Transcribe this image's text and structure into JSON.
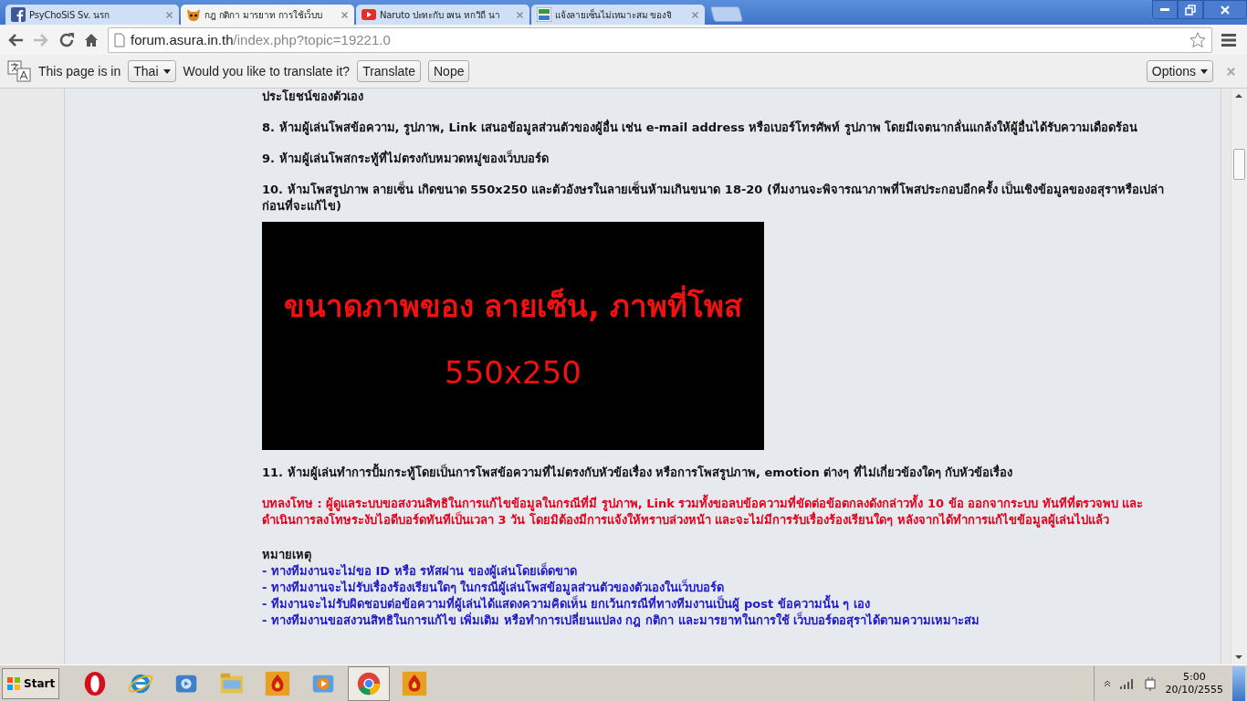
{
  "tabs": [
    {
      "title": "PsyChoSiS Sv. นรก",
      "selected": false
    },
    {
      "title": "กฎ กติกา มารยาท การใช้เว็บบ",
      "selected": true
    },
    {
      "title": "Naruto ปะทะกับ เพน หกวิถี นา",
      "selected": false
    },
    {
      "title": "แจ้งลายเซ็นไม่เหมาะสม ของจิ",
      "selected": false
    }
  ],
  "address_bar": {
    "host": "forum.asura.in.th",
    "path": "/index.php?topic=19221.0"
  },
  "translate_bar": {
    "prefix": "This page is in",
    "language": "Thai",
    "question": "Would you like to translate it?",
    "buttons": [
      "Translate",
      "Nope"
    ],
    "options": "Options"
  },
  "post": [
    {
      "kind": "rule",
      "text": "ประโยชน์ของตัวเอง"
    },
    {
      "kind": "rule",
      "text": "8. ห้ามผู้เล่นโพสข้อความ, รูปภาพ, Link เสนอข้อมูลส่วนตัวของผู้อื่น เช่น e-mail address หรือเบอร์โทรศัพท์ รูปภาพ โดยมีเจตนากลั่นแกล้งให้ผู้อื่นได้รับความเดือดร้อน"
    },
    {
      "kind": "rule",
      "text": "9. ห้ามผู้เล่นโพสกระทู้ที่ไม่ตรงกับหมวดหมู่ของเว็บบอร์ด"
    },
    {
      "kind": "rule",
      "text": "10. ห้ามโพสรูปภาพ ลายเซ็น เกิดขนาด 550x250 และตัวอังษรในลายเซ็นห้ามเกินขนาด 18-20 (ทีมงานจะพิจารณาภาพที่โพสประกอบอีกครั้ง เป็นเชิงข้อมูลของอสุราหรือเปล่า ก่อนที่จะแก้ไข)"
    },
    {
      "kind": "image",
      "lines": [
        "ขนาดภาพของ ลายเซ็น, ภาพที่โพส",
        "550x250"
      ]
    },
    {
      "kind": "rule",
      "text": "11. ห้ามผู้เล่นทำการปั้มกระทู้โดยเป็นการโพสข้อความที่ไม่ตรงกับหัวข้อเรื่อง หรือการโพสรูปภาพ, emotion ต่างๆ ที่ไม่เกี่ยวข้องใดๆ กับหัวข้อเรื่อง"
    },
    {
      "kind": "penalty",
      "text": "บทลงโทษ : ผู้ดูแลระบบขอสงวนสิทธิในการแก้ไขข้อมูลในกรณีที่มี รูปภาพ, Link รวมทั้งขอลบข้อความที่ขัดต่อข้อตกลงดังกล่าวทั้ง 10 ข้อ ออกจากระบบ ทันทีที่ตรวจพบ และดำเนินการลงโทษระงับไอดีบอร์ดทันทีเป็นเวลา 3 วัน โดยมิต้องมีการแจ้งให้ทราบล่วงหน้า และจะไม่มีการรับเรื่องร้องเรียนใดๆ หลังจากได้ทำการแก้ไขข้อมูลผู้เล่นไปแล้ว"
    },
    {
      "kind": "heading",
      "text": "หมายเหตุ"
    },
    {
      "kind": "note",
      "text": "- ทางทีมงานจะไม่ขอ ID หรือ รหัสผ่าน ของผู้เล่นโดยเด็ดขาด"
    },
    {
      "kind": "note",
      "text": "- ทางทีมงานจะไม่รับเรื่องร้องเรียนใดๆ ในกรณีผู้เล่นโพสข้อมูลส่วนตัวของตัวเองในเว็บบอร์ด"
    },
    {
      "kind": "note",
      "text": "- ทีมงานจะไม่รับผิดชอบต่อข้อความที่ผู้เล่นได้แสดงความคิดเห็น ยกเว้นกรณีที่ทางทีมงานเป็นผู้ post ข้อความนั้น ๆ เอง"
    },
    {
      "kind": "note",
      "text": "- ทางทีมงานขอสงวนสิทธิในการแก้ไข เพิ่มเติม หรือทำการเปลี่ยนแปลง กฎ กติกา และมารยาทในการใช้ เว็บบอร์ดอสุราได้ตามความเหมาะสม"
    }
  ],
  "taskbar": {
    "start": "Start",
    "apps": [
      {
        "selected": false
      },
      {
        "selected": false
      },
      {
        "selected": false
      },
      {
        "selected": false
      },
      {
        "selected": false
      },
      {
        "selected": false
      },
      {
        "selected": true
      },
      {
        "selected": false
      }
    ],
    "time": "5:00",
    "date": "20/10/2555"
  }
}
